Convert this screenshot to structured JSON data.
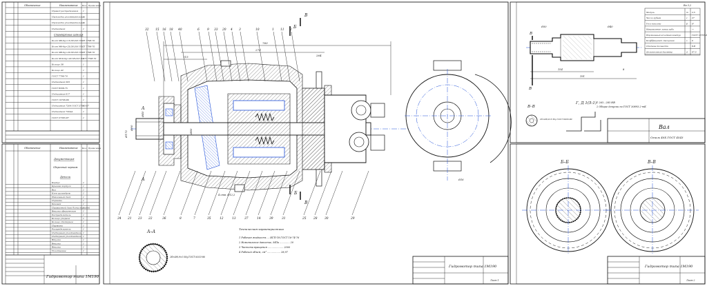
{
  "spec_sheet_1": {
    "col_headers": [
      "Обозначение",
      "Наименование",
      "Кол.",
      "Приме-чание"
    ],
    "rows": [
      "Привод распределения",
      "Прокладка уплотнительная",
      "Прокладка уплотнительная",
      "Подшипник",
      "Стандартные изделия",
      "Болт М6-6g×16.58.016 ГОСТ 7798-70",
      "Болт М6-6g×20.58.016 ГОСТ 7798-70",
      "Болт М8-6g×20.58.016 ГОСТ 7798-70",
      "Болт М10-6g×20.58.016 ГОСТ 7798-70",
      "Кольцо 38",
      "Кольцо 42",
      "ГОСТ 7796-74",
      "Подшипник 205",
      "ГОСТ 8338-75",
      "Подшипник 617",
      "ГОСТ 10706-80",
      "Подшипник 7204 ГОСТ 27365-87",
      "Подшипник 7204А",
      "ГОСТ 27365-87"
    ]
  },
  "spec_sheet_2": {
    "col_headers": [
      "Обозначение",
      "Наименование",
      "Кол.",
      "Приме-чание"
    ],
    "section_docs": "Документация",
    "doc_item": "Сборочный чертеж",
    "section_parts": "Детали",
    "rows": [
      "Корпус",
      "Крышка корпуса",
      "Вал",
      "Блок цилиндров",
      "Наклонный диск",
      "Поршень",
      "Башмак",
      "Прижимной диск блока поршней",
      "Втулка сферическая",
      "Распределитель",
      "Кольцо упорное",
      "Кольцо стопорное",
      "Пружина",
      "Распределитель",
      "Подпорный уплотнитель",
      "Подпорный уплотнитель",
      "Втулка",
      "Втулка",
      "Втулка",
      "Уплотнение"
    ],
    "title": "Гидромотор типа 1М190"
  },
  "assembly": {
    "section_label_a": "А",
    "section_label_b": "Б",
    "section_label_v": "В",
    "section_aa": "А–А",
    "spline_note": "2б×Ø8,9×5 Hq ГОСТ 6033-80",
    "callouts_top": [
      "32",
      "15",
      "16",
      "18",
      "40",
      "6",
      "9",
      "33",
      "20",
      "4",
      "3",
      "10",
      "1",
      "11",
      "2"
    ],
    "callouts_bottom": [
      "34",
      "21",
      "23",
      "22",
      "36",
      "8",
      "7",
      "35",
      "12",
      "13",
      "37",
      "14",
      "39",
      "31",
      "25",
      "28",
      "30",
      "29"
    ],
    "dims": {
      "d1": "760",
      "d2": "115",
      "d3": "270",
      "d4": "264",
      "d5": "Ø172",
      "d6": "Ø90",
      "d7": "Ø40",
      "d8": "Ø80",
      "d9": "4 отв. Ø12,2",
      "d10": "Ø16"
    },
    "tech_title": "Техническая характеристика",
    "tech_lines": [
      "1 Рабочая жидкость ... ИГП-18 ГОСТ 16-74-76",
      "2 Номинальное давление, МПа ............. 20",
      "3 Частота вращения .................... 2000",
      "4 Рабочий объем, см³ ................. 28,97"
    ],
    "title": "Гидромотор типа 1М190",
    "sheet": "Лист 1"
  },
  "shaft": {
    "param_headers": [
      "Параметр",
      "Знач."
    ],
    "params": [
      [
        "Модуль",
        "m",
        "2,5"
      ],
      [
        "Число зубьев",
        "z",
        "27"
      ],
      [
        "Угол наклона",
        "β",
        "0°"
      ],
      [
        "Направление линии зуба",
        "",
        "—"
      ],
      [
        "Нормальный исходный контур",
        "",
        "ГОСТ 13755-81"
      ],
      [
        "Коэффициент смещения",
        "x",
        "0"
      ],
      [
        "Степень точности",
        "",
        "8-В"
      ],
      [
        "Делительный диаметр",
        "d",
        "67,5"
      ]
    ],
    "roughness": "Ra 3,2",
    "notes": [
      "1 263...283 НВ",
      "2 Общие допуски по ГОСТ 30893.2-mК"
    ],
    "detail_label": "Г, Д 1(5:1)",
    "section_vv": "В–В",
    "spline_note": "2б×Ø8,9×5 Hq ГОСТ 6033-80",
    "part_name": "Вал",
    "material": "Сталь 40Х ГОСТ 4543",
    "dims": {
      "l1": "191",
      "l2": "154",
      "l3": "8",
      "l4": "Ø50",
      "l5": "Ø40"
    }
  },
  "sections_bb": {
    "label_bb": "Б–Б",
    "label_vv": "В–В",
    "title": "Гидромотор типа 1М190",
    "sheet": "Лист 2"
  },
  "title_block_labels": {
    "izm": "Изм.",
    "list": "Лист",
    "n_dokum": "№ докум.",
    "podp": "Подп.",
    "data": "Дата",
    "razrab": "Разраб.",
    "prov": "Пров.",
    "lit": "Лит.",
    "massa": "Масса",
    "masshtab": "Масштаб"
  }
}
